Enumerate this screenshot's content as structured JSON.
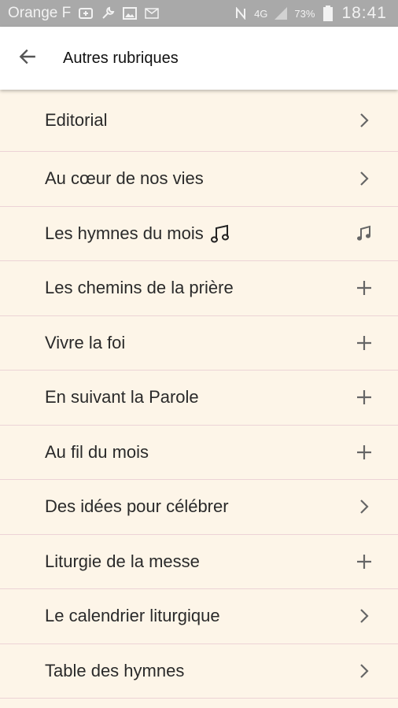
{
  "status_bar": {
    "carrier": "Orange F",
    "network": "4G",
    "battery": "73%",
    "time": "18:41",
    "icons": [
      "notification-icon",
      "wrench-icon",
      "image-icon",
      "gmail-icon",
      "nfc-icon",
      "signal-icon",
      "battery-icon"
    ]
  },
  "app_bar": {
    "title": "Autres rubriques",
    "back_icon": "arrow-back-icon"
  },
  "menu": {
    "items": [
      {
        "label": "Editorial",
        "icon": "chevron-right-icon"
      },
      {
        "label": "Au cœur de nos vies",
        "icon": "chevron-right-icon"
      },
      {
        "label": "Les hymnes du mois",
        "icon": "music-note-icon",
        "inline_icon": "music-note-icon"
      },
      {
        "label": "Les chemins de la prière",
        "icon": "plus-icon"
      },
      {
        "label": "Vivre la foi",
        "icon": "plus-icon"
      },
      {
        "label": "En suivant la Parole",
        "icon": "plus-icon"
      },
      {
        "label": "Au fil du mois",
        "icon": "plus-icon"
      },
      {
        "label": "Des idées pour célébrer",
        "icon": "chevron-right-icon"
      },
      {
        "label": "Liturgie de la messe",
        "icon": "plus-icon"
      },
      {
        "label": "Le calendrier liturgique",
        "icon": "chevron-right-icon"
      },
      {
        "label": "Table des hymnes",
        "icon": "chevron-right-icon"
      }
    ]
  },
  "colors": {
    "background": "#fdf5e8",
    "divider": "#ecd3d6",
    "app_bar": "#ffffff",
    "status_bar": "#a9a9a9"
  }
}
